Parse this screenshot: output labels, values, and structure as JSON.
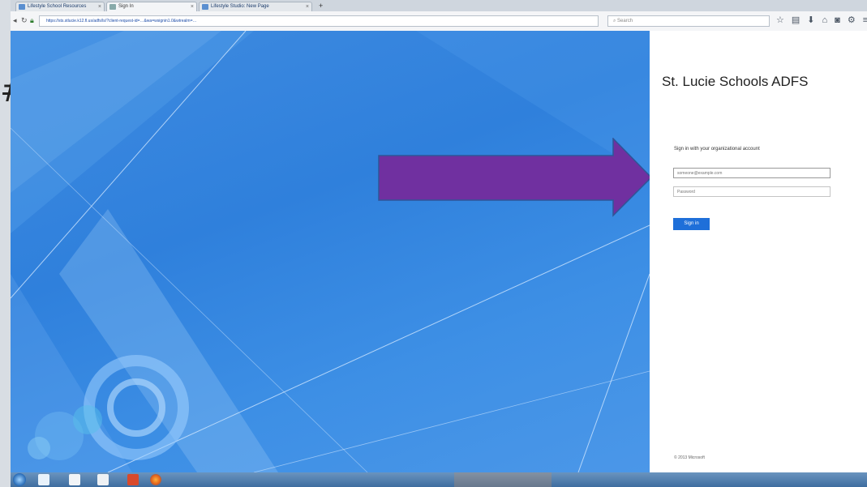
{
  "slide": {
    "fragment_text": "#"
  },
  "browser": {
    "tabs": [
      {
        "label": "Lifestyle School Resources",
        "active": false
      },
      {
        "label": "Sign In",
        "active": true
      },
      {
        "label": "Lifestyle Studio: New Page",
        "active": false
      }
    ],
    "new_tab_label": "+",
    "url": "https://sts.stlucie.k12.fl.us/adfs/ls/?client-request-id=…&wa=wsignin1.0&wtrealm=…",
    "search_placeholder": "Search",
    "toolbar_icons": [
      "bookmark-star-icon",
      "library-icon",
      "download-icon",
      "home-icon",
      "pocket-icon",
      "extensions-icon",
      "menu-icon"
    ]
  },
  "adfs": {
    "org_title": "St. Lucie Schools ADFS",
    "sign_in_prompt": "Sign in with your organizational account",
    "username_placeholder": "someone@example.com",
    "password_placeholder": "Password",
    "sign_in_label": "Sign in",
    "copyright": "© 2013 Microsoft"
  },
  "annotation": {
    "color": "#7030a0",
    "border_color": "#2f5597"
  },
  "taskbar": {
    "apps": [
      "explorer-icon",
      "folder-icon",
      "folder-icon",
      "powerpoint-icon",
      "firefox-icon"
    ],
    "clock_time": "",
    "clock_date": ""
  },
  "colors": {
    "adfs_blue": "#2f80dc",
    "button_blue": "#1e6fd9"
  }
}
